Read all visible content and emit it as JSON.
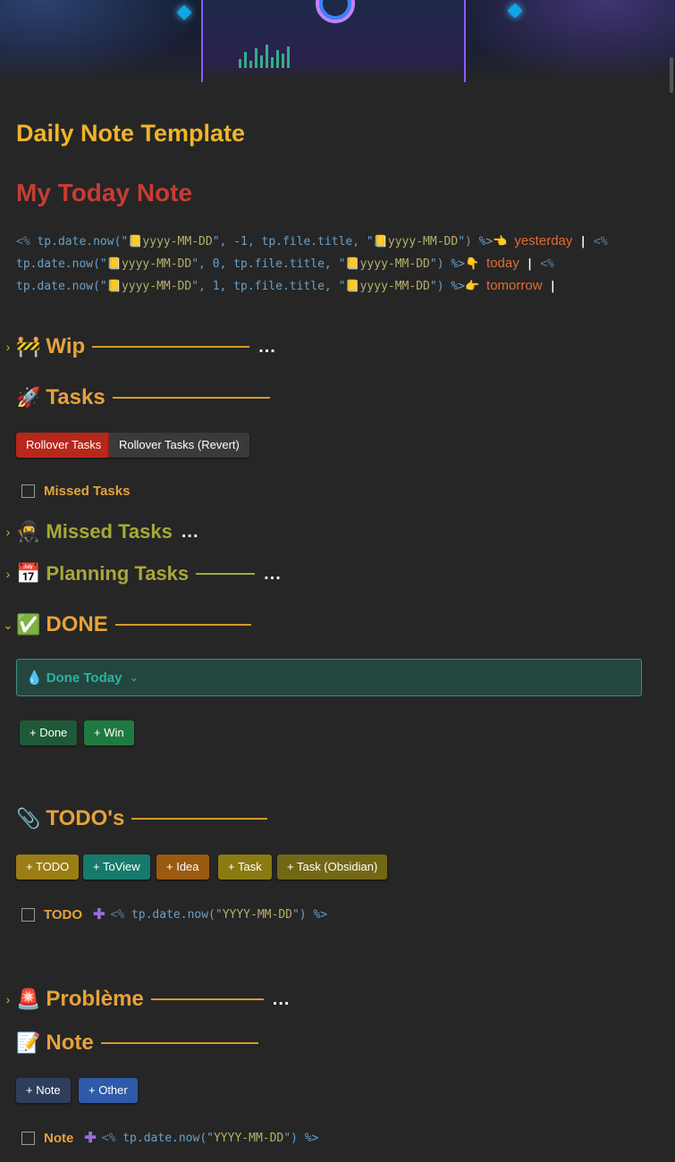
{
  "title": "Daily Note Template",
  "heading": "My Today Note",
  "nav_code": {
    "line1": {
      "open": "<%",
      "fn": "tp.date.now(\"",
      "fmt1": "yyyy-MM-DD",
      "arg": "\", -1, tp.file.title, \"",
      "fmt2": "yyyy-MM-DD",
      "close": "\") %>",
      "link": "yesterday",
      "sep": "|",
      "tail": "<%"
    },
    "line2": {
      "fn": "tp.date.now(\"",
      "fmt1": "yyyy-MM-DD",
      "arg": "\", 0, tp.file.title, \"",
      "fmt2": "yyyy-MM-DD",
      "close": "\") %>",
      "link": "today",
      "sep": "|",
      "tail": "<%"
    },
    "line3": {
      "fn": "tp.date.now(\"",
      "fmt1": "yyyy-MM-DD",
      "arg": "\", 1, tp.file.title, \"",
      "fmt2": "yyyy-MM-DD",
      "close": "\") %>",
      "link": "tomorrow",
      "sep": "|"
    }
  },
  "sections": {
    "wip": {
      "emoji": "🚧",
      "title": "Wip",
      "color": "#e6a23c"
    },
    "tasks": {
      "emoji": "🚀",
      "title": "Tasks",
      "color": "#e6a23c"
    },
    "missed": {
      "emoji": "🥷",
      "title": "Missed Tasks",
      "color": "#a7a83a"
    },
    "planning": {
      "emoji": "📅",
      "title": "Planning Tasks",
      "color": "#a7a83a"
    },
    "done": {
      "emoji": "✅",
      "title": "DONE",
      "color": "#e6a23c"
    },
    "todo": {
      "emoji": "📎",
      "title": "TODO's",
      "color": "#e6a23c"
    },
    "probleme": {
      "emoji": "🚨",
      "title": "Problème",
      "color": "#e6a23c"
    },
    "note": {
      "emoji": "📝",
      "title": "Note",
      "color": "#e6a23c"
    }
  },
  "ellipsis": "...",
  "buttons": {
    "rollover": "Rollover Tasks",
    "rollover_revert": "Rollover Tasks (Revert)",
    "done": "+ Done",
    "win": "+ Win",
    "todo": "+ TODO",
    "toview": "+ ToView",
    "idea": "+ Idea",
    "task": "+ Task",
    "task_obsidian": "+ Task (Obsidian)",
    "note": "+ Note",
    "other": "+ Other"
  },
  "tasks": {
    "missed": "Missed Tasks",
    "todo": "TODO",
    "note": "Note",
    "todo_code": {
      "open": "<%",
      "fn": "tp.date.now(\"",
      "fmt": "YYYY-MM-DD",
      "close": "\") %>"
    }
  },
  "callout": {
    "title": "Done Today"
  },
  "icons": {
    "chevron_right": "›",
    "chevron_down": "⌄",
    "plus": "✚",
    "droplet": "💧",
    "calendar": "📒"
  }
}
